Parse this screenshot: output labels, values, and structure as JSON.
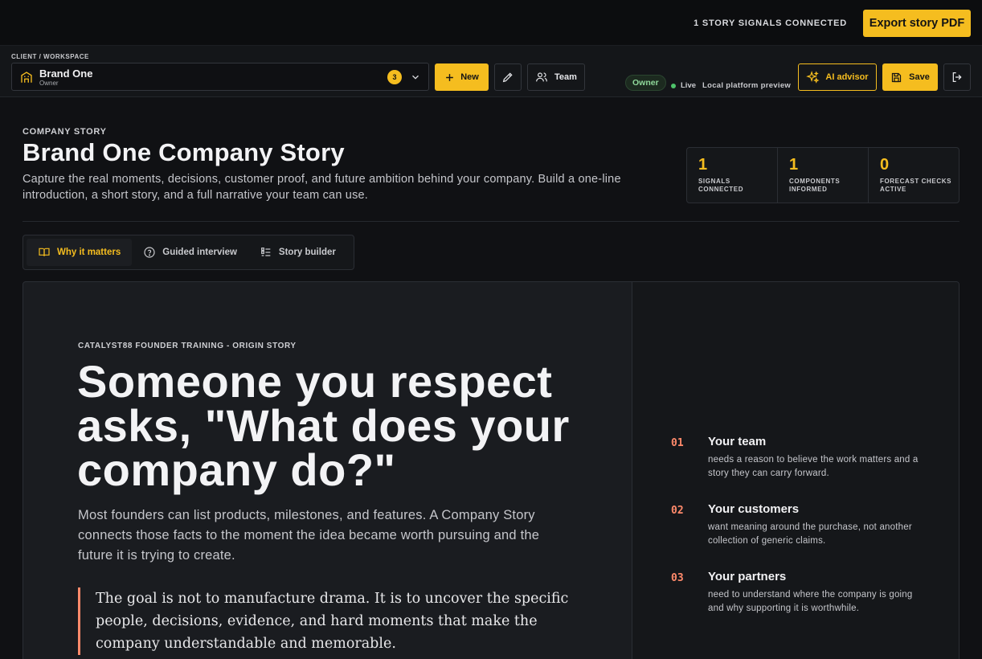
{
  "topbar": {
    "signals_label": "1 STORY SIGNALS CONNECTED",
    "export_label": "Export story PDF"
  },
  "workspace": {
    "caption": "CLIENT / WORKSPACE",
    "name": "Brand One",
    "role": "Owner",
    "count": "3"
  },
  "toolbar": {
    "new_label": "New",
    "team_label": "Team",
    "owner_badge": "Owner",
    "live_label": "Live",
    "preview_label": "Local platform preview",
    "ai_label": "AI advisor",
    "save_label": "Save"
  },
  "header": {
    "eyebrow": "COMPANY STORY",
    "title": "Brand One Company Story",
    "description": "Capture the real moments, decisions, customer proof, and future ambition behind your company. Build a one-line introduction, a short story, and a full narrative your team can use."
  },
  "stats": [
    {
      "value": "1",
      "label": "SIGNALS CONNECTED"
    },
    {
      "value": "1",
      "label": "COMPONENTS INFORMED"
    },
    {
      "value": "0",
      "label": "FORECAST CHECKS ACTIVE"
    }
  ],
  "tabs": [
    {
      "label": "Why it matters",
      "icon": "book-open-icon",
      "active": true
    },
    {
      "label": "Guided interview",
      "icon": "question-circle-icon",
      "active": false
    },
    {
      "label": "Story builder",
      "icon": "list-icon",
      "active": false
    }
  ],
  "story": {
    "kicker": "CATALYST88 FOUNDER TRAINING - ORIGIN STORY",
    "headline": "Someone you respect asks, \"What does your company do?\"",
    "body": "Most founders can list products, milestones, and features. A Company Story connects those facts to the moment the idea became worth pursuing and the future it is trying to create.",
    "quote": "The goal is not to manufacture drama. It is to uncover the specific people, decisions, evidence, and hard moments that make the company understandable and memorable."
  },
  "reasons": [
    {
      "num": "01",
      "title": "Your team",
      "text": "needs a reason to believe the work matters and a story they can carry forward."
    },
    {
      "num": "02",
      "title": "Your customers",
      "text": "want meaning around the purchase, not another collection of generic claims."
    },
    {
      "num": "03",
      "title": "Your partners",
      "text": "need to understand where the company is going and why supporting it is worthwhile."
    }
  ],
  "colors": {
    "accent": "#f5bd1f",
    "coral": "#ff8a6b",
    "live": "#4ec26a"
  }
}
